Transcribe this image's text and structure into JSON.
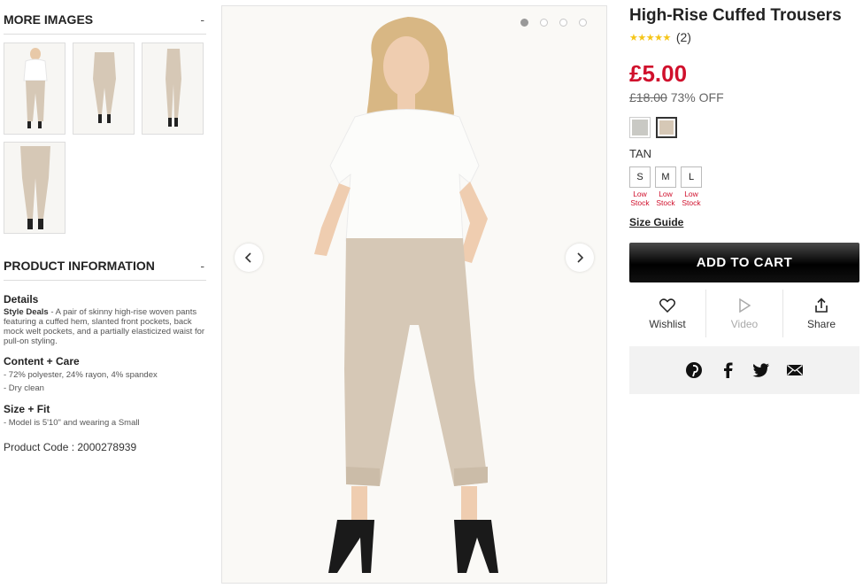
{
  "more_images": {
    "title": "MORE IMAGES",
    "toggle": "-"
  },
  "thumbnails": [
    {
      "name": "front-view"
    },
    {
      "name": "side-view"
    },
    {
      "name": "back-side-view"
    },
    {
      "name": "pants-closeup"
    }
  ],
  "product_info": {
    "title": "PRODUCT INFORMATION",
    "toggle": "-",
    "details_title": "Details",
    "details_brand": "Style Deals",
    "details_text": " - A pair of skinny high-rise woven pants featuring a cuffed hem, slanted front pockets, back mock welt pockets, and a partially elasticized waist for pull-on styling.",
    "content_title": "Content + Care",
    "content_items": [
      "- 72% polyester, 24% rayon, 4% spandex",
      "- Dry clean"
    ],
    "size_title": "Size + Fit",
    "size_items": [
      "- Model is 5'10\" and wearing a Small"
    ],
    "product_code": "Product Code : 2000278939"
  },
  "gallery": {
    "dots": 4,
    "active_dot": 0,
    "prev_icon": "chevron-left-icon",
    "next_icon": "chevron-right-icon"
  },
  "product": {
    "title": "High-Rise Cuffed Trousers",
    "stars": "★★★★★",
    "rating_count": "(2)",
    "price": "£5.00",
    "was_price": "£18.00",
    "discount": " 73% OFF",
    "swatches": [
      {
        "name": "grey",
        "color": "#c9c9c4",
        "selected": false
      },
      {
        "name": "tan",
        "color": "#d6c8b6",
        "selected": true
      }
    ],
    "color_name": "TAN",
    "sizes": [
      {
        "label": "S",
        "status": "Low Stock"
      },
      {
        "label": "M",
        "status": "Low Stock"
      },
      {
        "label": "L",
        "status": "Low Stock"
      }
    ],
    "size_guide": "Size Guide",
    "add_to_cart": "ADD TO CART",
    "actions": {
      "wishlist": "Wishlist",
      "video": "Video",
      "share": "Share"
    }
  },
  "colors": {
    "price_red": "#d0102c",
    "star_yellow": "#f5c518",
    "pant_tan": "#d6c8b6"
  }
}
